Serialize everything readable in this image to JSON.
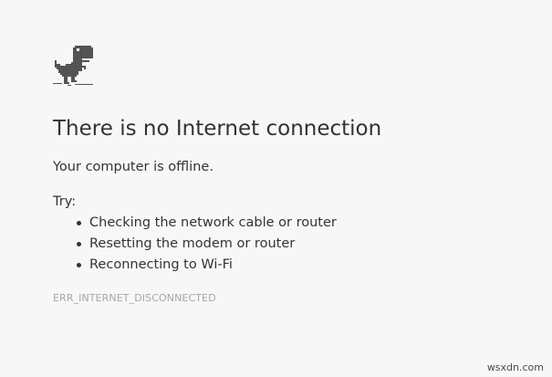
{
  "icon": "dino-icon",
  "heading": "There is no Internet connection",
  "message": "Your computer is offline.",
  "try_label": "Try:",
  "suggestions": [
    "Checking the network cable or router",
    "Resetting the modem or router",
    "Reconnecting to Wi-Fi"
  ],
  "error_code": "ERR_INTERNET_DISCONNECTED",
  "watermark": "wsxdn.com",
  "colors": {
    "background": "#f7f7f7",
    "text": "#333333",
    "error_code": "#a6a6a6",
    "dino": "#535353"
  }
}
